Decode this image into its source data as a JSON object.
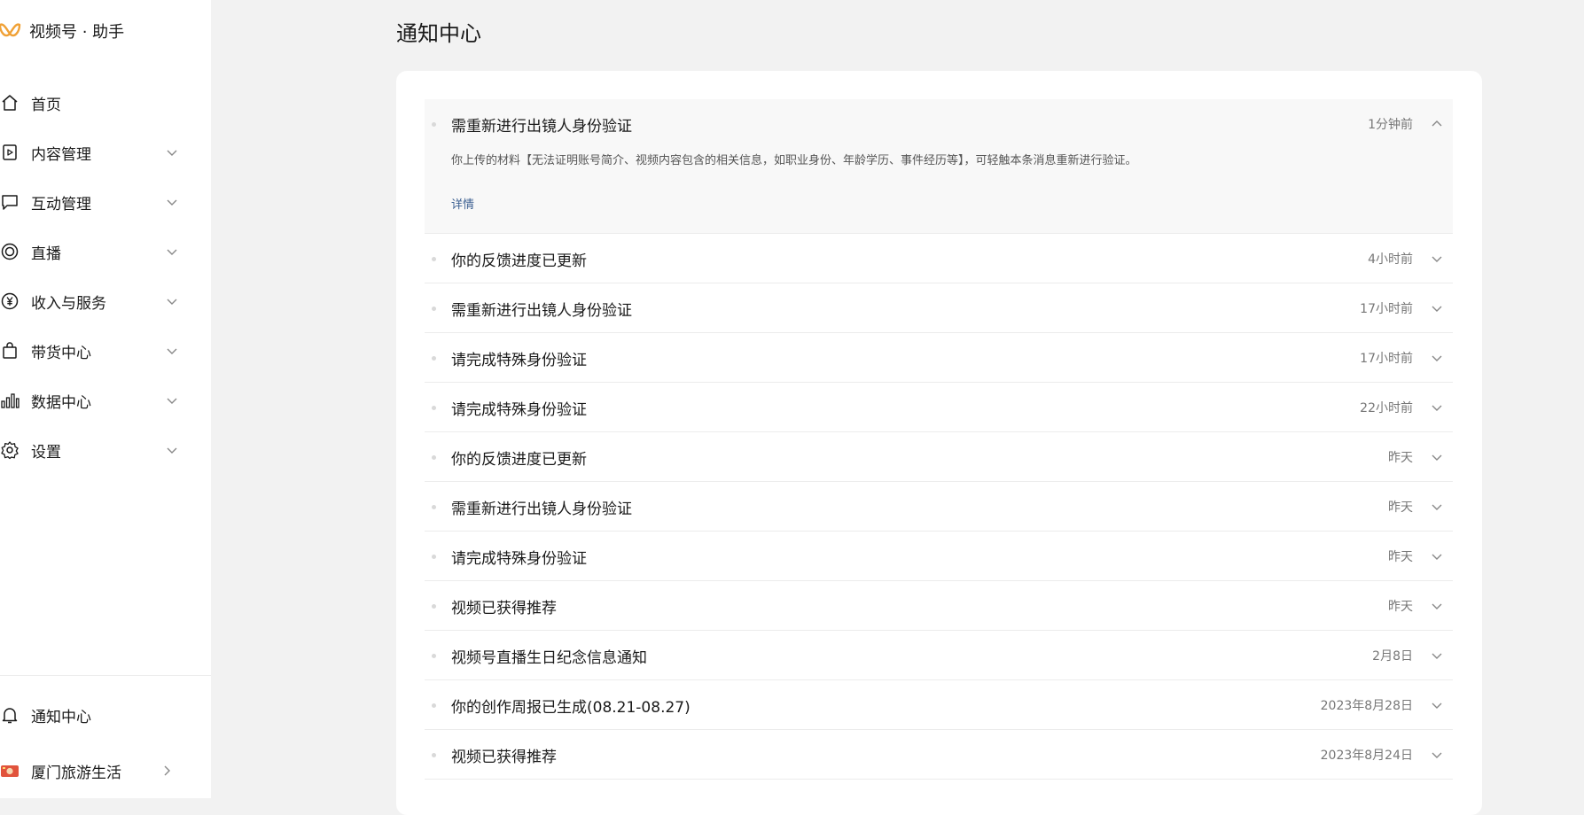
{
  "brand": {
    "title": "视频号 · 助手",
    "logo_color": "#f0a136"
  },
  "nav": [
    {
      "id": "home",
      "label": "首页",
      "icon": "home-icon"
    },
    {
      "id": "content",
      "label": "内容管理",
      "icon": "content-icon"
    },
    {
      "id": "interaction",
      "label": "互动管理",
      "icon": "message-icon"
    },
    {
      "id": "live",
      "label": "直播",
      "icon": "live-icon"
    },
    {
      "id": "income",
      "label": "收入与服务",
      "icon": "yen-icon"
    },
    {
      "id": "commerce",
      "label": "带货中心",
      "icon": "bag-icon"
    },
    {
      "id": "data",
      "label": "数据中心",
      "icon": "chart-icon"
    },
    {
      "id": "settings",
      "label": "设置",
      "icon": "gear-icon"
    }
  ],
  "bottom": {
    "notifications_label": "通知中心",
    "account_label": "厦门旅游生活"
  },
  "page": {
    "title": "通知中心"
  },
  "notifications": [
    {
      "title": "需重新进行出镜人身份验证",
      "time": "1分钟前",
      "expanded": true,
      "description": "你上传的材料【无法证明账号简介、视频内容包含的相关信息，如职业身份、年龄学历、事件经历等】，可轻触本条消息重新进行验证。",
      "detail_label": "详情"
    },
    {
      "title": "你的反馈进度已更新",
      "time": "4小时前"
    },
    {
      "title": "需重新进行出镜人身份验证",
      "time": "17小时前"
    },
    {
      "title": "请完成特殊身份验证",
      "time": "17小时前"
    },
    {
      "title": "请完成特殊身份验证",
      "time": "22小时前"
    },
    {
      "title": "你的反馈进度已更新",
      "time": "昨天"
    },
    {
      "title": "需重新进行出镜人身份验证",
      "time": "昨天"
    },
    {
      "title": "请完成特殊身份验证",
      "time": "昨天"
    },
    {
      "title": "视频已获得推荐",
      "time": "昨天"
    },
    {
      "title": "视频号直播生日纪念信息通知",
      "time": "2月8日"
    },
    {
      "title": "你的创作周报已生成(08.21-08.27)",
      "time": "2023年8月28日"
    },
    {
      "title": "视频已获得推荐",
      "time": "2023年8月24日"
    }
  ],
  "colors": {
    "link": "#3b5f91",
    "background": "#f2f2f2"
  }
}
